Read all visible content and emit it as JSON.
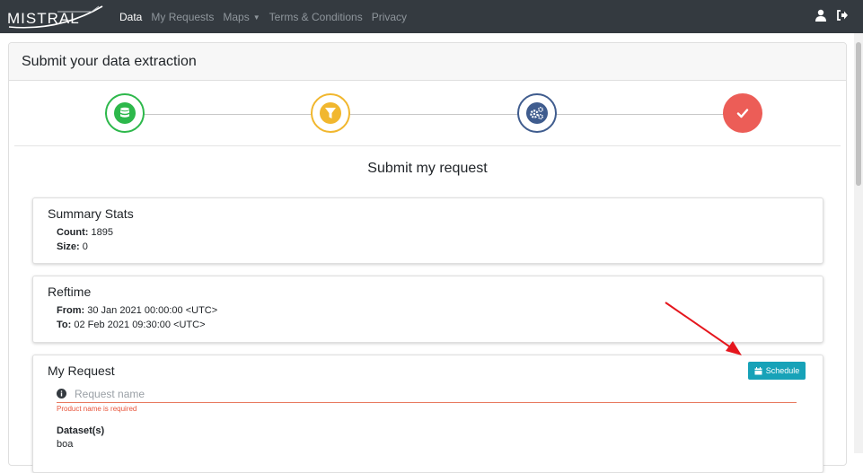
{
  "app": {
    "logo_text": "MISTRAL"
  },
  "navbar": {
    "items": [
      {
        "label": "Data",
        "active": true
      },
      {
        "label": "My Requests",
        "active": false
      },
      {
        "label": "Maps",
        "active": false,
        "dropdown": true
      },
      {
        "label": "Terms & Conditions",
        "active": false
      },
      {
        "label": "Privacy",
        "active": false
      }
    ],
    "right_icons": [
      "user-icon",
      "sign-out-icon"
    ]
  },
  "card": {
    "title": "Submit your data extraction"
  },
  "stepper": {
    "steps": [
      {
        "icon": "database-icon",
        "color": "#2db84b"
      },
      {
        "icon": "filter-icon",
        "color": "#f1b72e"
      },
      {
        "icon": "cogs-icon",
        "color": "#3f5c8e"
      },
      {
        "icon": "check-icon",
        "color": "#ec5d57"
      }
    ]
  },
  "section_title": "Submit my request",
  "summary": {
    "title": "Summary Stats",
    "count_label": "Count:",
    "count_value": "1895",
    "size_label": "Size:",
    "size_value": "0"
  },
  "reftime": {
    "title": "Reftime",
    "from_label": "From:",
    "from_value": "30 Jan 2021 00:00:00 <UTC>",
    "to_label": "To:",
    "to_value": "02 Feb 2021 09:30:00 <UTC>"
  },
  "my_request": {
    "title": "My Request",
    "schedule_label": "Schedule",
    "name_placeholder": "Request name",
    "name_value": "",
    "error": "Product name is required",
    "dataset_label": "Dataset(s)",
    "dataset_value": "boa"
  },
  "colors": {
    "navbar_bg": "#343a40",
    "schedule_btn": "#17a2b8",
    "error": "#e8543a",
    "annotation_arrow": "#e5161d"
  }
}
